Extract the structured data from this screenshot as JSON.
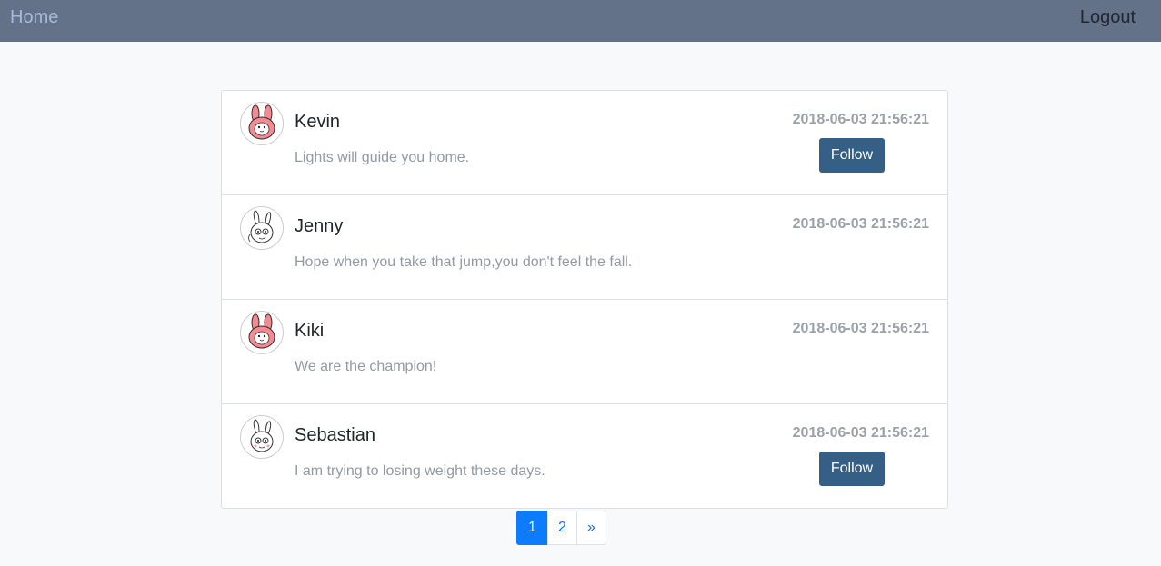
{
  "nav": {
    "home_label": "Home",
    "logout_label": "Logout"
  },
  "posts": [
    {
      "name": "Kevin",
      "message": "Lights will guide you home.",
      "timestamp": "2018-06-03 21:56:21",
      "avatar_icon": "pink-rabbit-icon",
      "follow_label": "Follow"
    },
    {
      "name": "Jenny",
      "message": "Hope when you take that jump,you don't feel the fall.",
      "timestamp": "2018-06-03 21:56:21",
      "avatar_icon": "white-rabbit-icon"
    },
    {
      "name": "Kiki",
      "message": "We are the champion!",
      "timestamp": "2018-06-03 21:56:21",
      "avatar_icon": "pink-rabbit-icon"
    },
    {
      "name": "Sebastian",
      "message": "I am trying to losing weight these days.",
      "timestamp": "2018-06-03 21:56:21",
      "avatar_icon": "white-rabbit-icon",
      "follow_label": "Follow"
    }
  ],
  "pagination": {
    "pages": [
      "1",
      "2"
    ],
    "next_label": "»",
    "current_page": "1"
  },
  "colors": {
    "navbar": "#637189",
    "follow_button": "#355f84",
    "active_page": "#0d7bfd"
  }
}
